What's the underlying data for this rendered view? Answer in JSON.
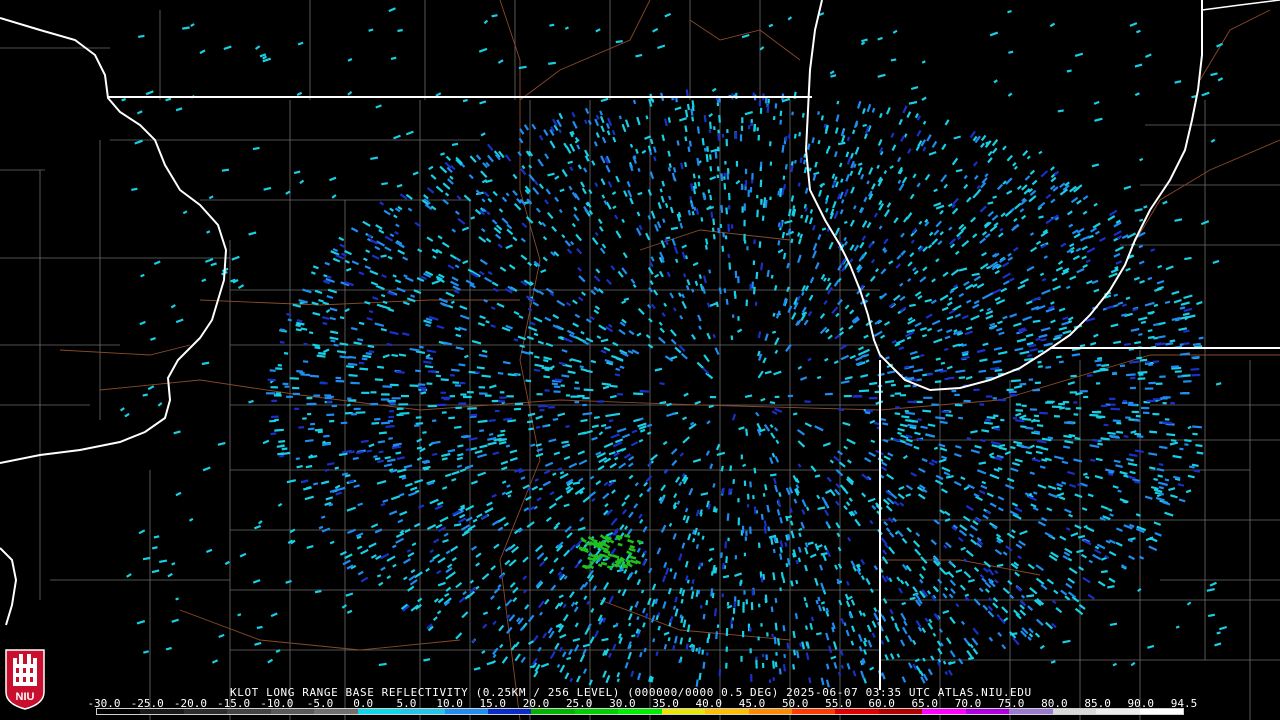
{
  "caption": "KLOT LONG RANGE BASE REFLECTIVITY (0.25KM / 256 LEVEL) (000000/0000 0.5 DEG) 2025-06-07 03:35 UTC  ATLAS.NIU.EDU",
  "scale": {
    "labels": [
      "-30.0",
      "-25.0",
      "-20.0",
      "-15.0",
      "-10.0",
      "-5.0",
      "0.0",
      "5.0",
      "10.0",
      "15.0",
      "20.0",
      "25.0",
      "30.0",
      "35.0",
      "40.0",
      "45.0",
      "50.0",
      "55.0",
      "60.0",
      "65.0",
      "70.0",
      "75.0",
      "80.0",
      "85.0",
      "90.0",
      "94.5"
    ],
    "colors": [
      "#000000",
      "#1a1a1a",
      "#2e2e2e",
      "#444444",
      "#5a5a5a",
      "#707070",
      "#0ed8e8",
      "#23c6ea",
      "#1e8ff0",
      "#0a2cc8",
      "#00b400",
      "#00d000",
      "#00ee00",
      "#e8e800",
      "#ffbe00",
      "#ff8a00",
      "#ff3c00",
      "#e00000",
      "#b40000",
      "#ff00ff",
      "#b000e0",
      "#9a7ad0",
      "#d8d8d8",
      "#ececec",
      "#ffffff"
    ]
  },
  "logo": {
    "text": "NIU",
    "color": "#c8102e"
  },
  "map_colors": {
    "state_lines": "#ffffff",
    "county_lines": "#6d6d6d",
    "highways": "#8a4a2a",
    "echo_primary": "#18d0e6",
    "echo_secondary": "#1e8cf0",
    "echo_strong": "#1a30c8",
    "echo_green": "#20c020"
  }
}
